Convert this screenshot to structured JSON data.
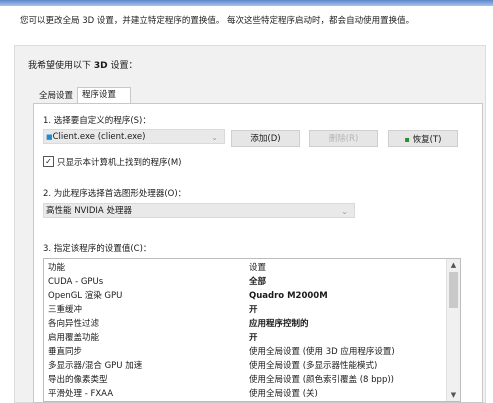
{
  "description": "您可以更改全局 3D 设置，并建立特定程序的置换值。 每次这些特定程序启动时，都会自动使用置换值。",
  "heading": {
    "prefix": "我希望使用以下 ",
    "bold": "3D",
    "suffix": " 设置："
  },
  "tabs": [
    {
      "label": "全局设置",
      "selected": false
    },
    {
      "label": "程序设置",
      "selected": true
    }
  ],
  "step1": {
    "label": "1. 选择要自定义的程序(S)：",
    "program_value": "Client.exe (client.exe)",
    "add_label": "添加(D)",
    "delete_label": "删除(R)",
    "restore_label": "恢复(T)",
    "only_show_label": "只显示本计算机上找到的程序(M)",
    "only_show_checked": true
  },
  "step2": {
    "label": "2. 为此程序选择首选图形处理器(O)：",
    "gpu_value": "高性能 NVIDIA 处理器"
  },
  "step3": {
    "label": "3. 指定该程序的设置值(C)：",
    "columns": [
      "功能",
      "设置"
    ],
    "rows": [
      {
        "feature": "CUDA - GPUs",
        "setting": "全部",
        "bold": true
      },
      {
        "feature": "OpenGL 渲染 GPU",
        "setting": "Quadro M2000M",
        "bold": true
      },
      {
        "feature": "三重缓冲",
        "setting": "开",
        "bold": true
      },
      {
        "feature": "各向异性过滤",
        "setting": "应用程序控制的",
        "bold": true
      },
      {
        "feature": "启用覆盖功能",
        "setting": "开",
        "bold": true
      },
      {
        "feature": "垂直同步",
        "setting": "使用全局设置 (使用 3D 应用程序设置)",
        "bold": false
      },
      {
        "feature": "多显示器/混合 GPU 加速",
        "setting": "使用全局设置 (多显示器性能模式)",
        "bold": false
      },
      {
        "feature": "导出的像素类型",
        "setting": "使用全局设置 (颜色索引覆盖 (8 bpp))",
        "bold": false
      },
      {
        "feature": "平滑处理 - FXAA",
        "setting": "使用全局设置 (关)",
        "bold": false
      }
    ]
  },
  "colors": {
    "panel": "#f1f1f1",
    "topbar": "#5b86c9"
  }
}
